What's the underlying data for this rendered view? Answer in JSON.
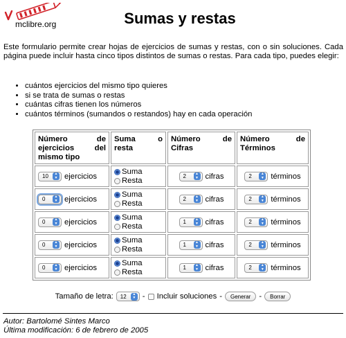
{
  "logo": {
    "text": "mclibre.org"
  },
  "page_title": "Sumas y restas",
  "intro": "Este formulario permite crear hojas de ejercicios de sumas y restas, con o sin soluciones. Cada página puede incluir hasta cinco tipos distintos de sumas o restas. Para cada tipo, puedes elegir:",
  "bullets": [
    "cuántos ejercicios del mismo tipo quieres",
    "si se trata de sumas o restas",
    "cuántas cifras tienen los números",
    "cuántos términos (sumandos o restandos) hay en cada operación"
  ],
  "table": {
    "headers": [
      "Número de ejercicios del mismo tipo",
      "Suma o resta",
      "Número de Cifras",
      "Número de Términos"
    ],
    "ejercicios_label": "ejercicios",
    "suma_label": "Suma",
    "resta_label": "Resta",
    "cifras_label": "cifras",
    "terminos_label": "términos",
    "rows": [
      {
        "ejercicios": "10",
        "operacion": "Suma",
        "cifras": "2",
        "terminos": "2"
      },
      {
        "ejercicios": "0",
        "operacion": "Suma",
        "cifras": "2",
        "terminos": "2"
      },
      {
        "ejercicios": "0",
        "operacion": "Suma",
        "cifras": "1",
        "terminos": "2"
      },
      {
        "ejercicios": "0",
        "operacion": "Suma",
        "cifras": "1",
        "terminos": "2"
      },
      {
        "ejercicios": "0",
        "operacion": "Suma",
        "cifras": "1",
        "terminos": "2"
      }
    ]
  },
  "options": {
    "font_size_label": "Tamaño de letra:",
    "font_size_value": "12",
    "sep": "-",
    "solutions_label": "Incluir soluciones",
    "solutions_checked": false,
    "generate_button": "Generar",
    "clear_button": "Borrar"
  },
  "footer": {
    "author": "Autor: Bartolomé Sintes Marco",
    "modified": "Última modificación: 6 de febrero de 2005"
  },
  "colors": {
    "logo_red": "#d2232a",
    "select_arrow_blue": "#4a86d6",
    "focus_ring": "#7aa7e0"
  }
}
